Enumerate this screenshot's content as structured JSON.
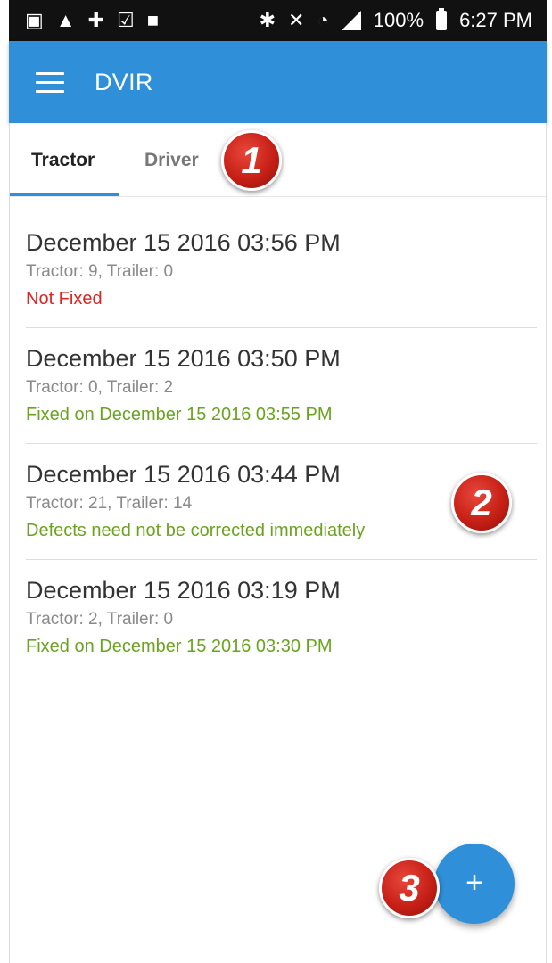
{
  "status_bar": {
    "battery": "100%",
    "time": "6:27 PM",
    "left_icons": [
      "image-icon",
      "warning-icon",
      "plus-circle-icon",
      "clipboard-check-icon",
      "briefcase-icon"
    ],
    "right_icons": [
      "bluetooth-icon",
      "mute-icon",
      "wifi-icon",
      "signal-icon",
      "battery-icon"
    ]
  },
  "app_bar": {
    "title": "DVIR",
    "menu_icon": "hamburger-icon"
  },
  "tabs": [
    {
      "label": "Tractor",
      "active": true
    },
    {
      "label": "Driver",
      "active": false
    }
  ],
  "inspections": [
    {
      "date": "December 15 2016 03:56 PM",
      "counts": "Tractor: 9, Trailer: 0",
      "status": "Not Fixed",
      "status_color": "#e02424"
    },
    {
      "date": "December 15 2016 03:50 PM",
      "counts": "Tractor: 0, Trailer: 2",
      "status": "Fixed on December 15 2016 03:55 PM",
      "status_color": "#6aa41f"
    },
    {
      "date": "December 15 2016 03:44 PM",
      "counts": "Tractor: 21, Trailer: 14",
      "status": "Defects need not be corrected immediately",
      "status_color": "#6aa41f"
    },
    {
      "date": "December 15 2016 03:19 PM",
      "counts": "Tractor: 2, Trailer: 0",
      "status": "Fixed on December 15 2016 03:30 PM",
      "status_color": "#6aa41f"
    }
  ],
  "callouts": [
    "1",
    "2",
    "3"
  ],
  "fab": {
    "label": "+",
    "icon": "add-icon"
  },
  "colors": {
    "primary": "#2f8fd8",
    "status_bar": "#111111",
    "callout": "#c72016"
  }
}
